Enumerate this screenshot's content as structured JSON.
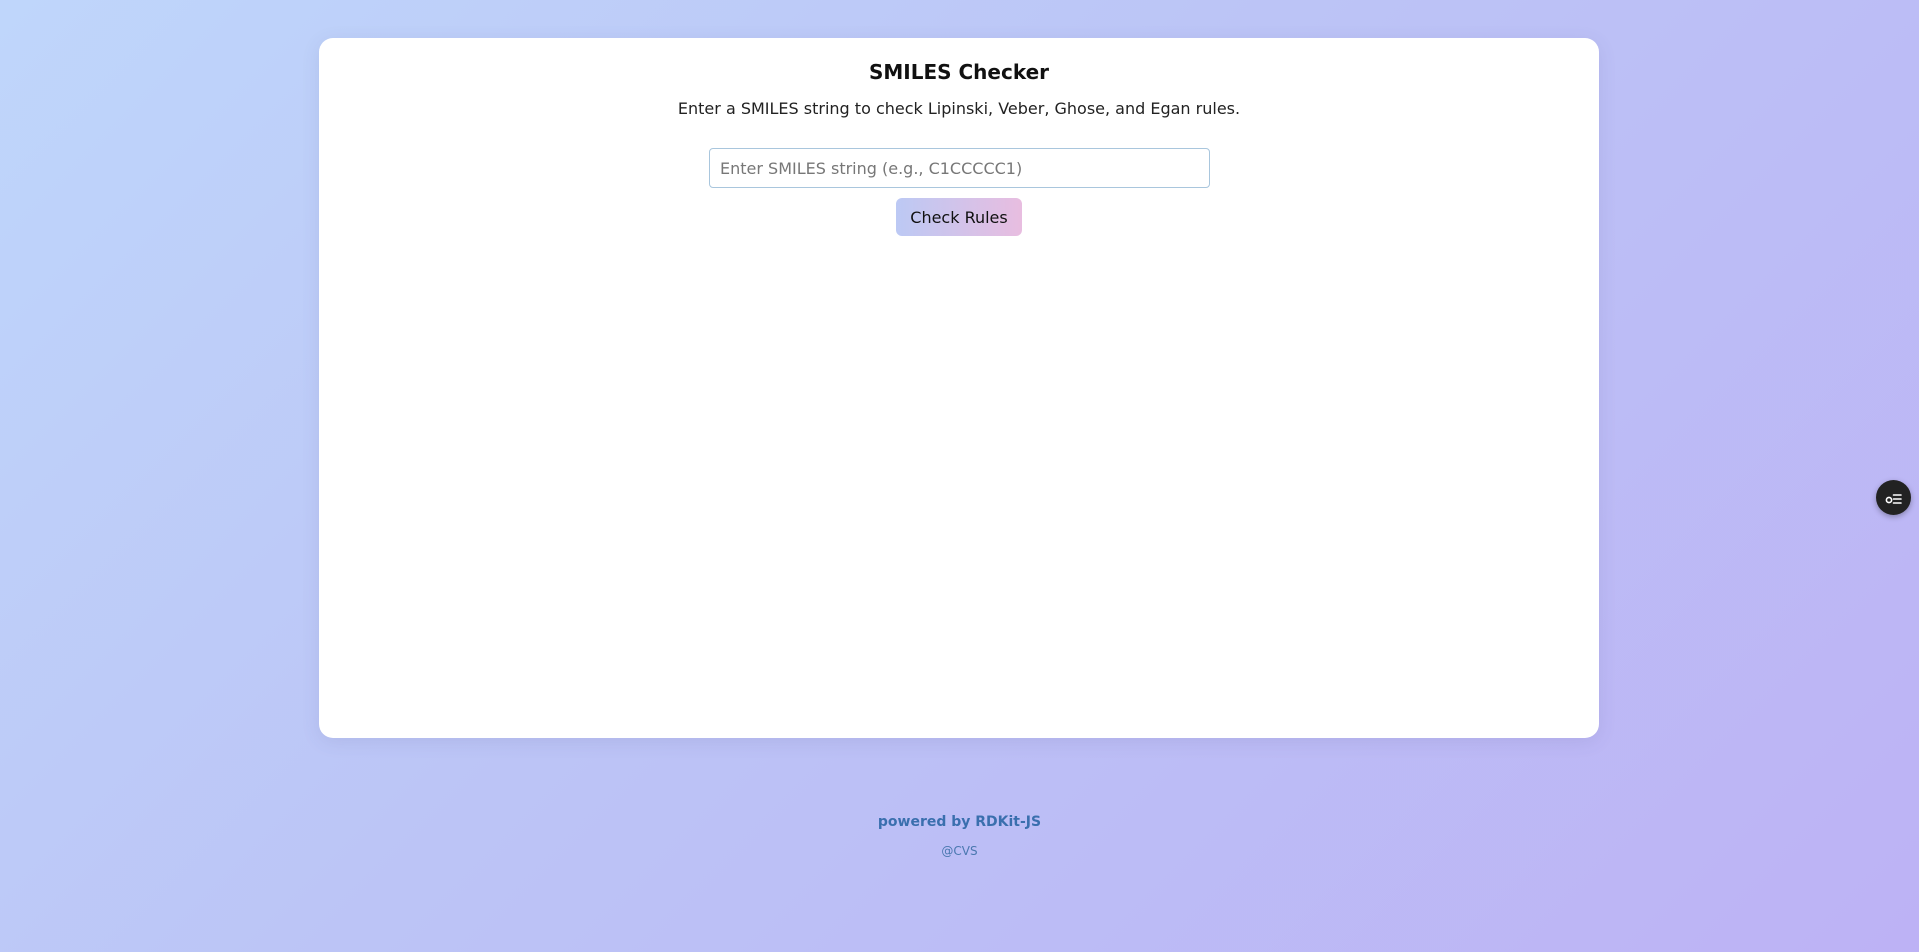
{
  "card": {
    "title": "SMILES Checker",
    "subtitle": "Enter a SMILES string to check Lipinski, Veber, Ghose, and Egan rules.",
    "input": {
      "value": "",
      "placeholder": "Enter SMILES string (e.g., C1CCCCC1)"
    },
    "check_button_label": "Check Rules"
  },
  "footer": {
    "powered_by": "powered by RDKit-JS",
    "credit": "@CVS"
  },
  "widget": {
    "icon": "settings-toggle-icon"
  },
  "colors": {
    "background_start": "#bfd6fb",
    "background_end": "#bdb2f5",
    "card": "#ffffff",
    "button_gradient_start": "#bcc9f4",
    "button_gradient_end": "#e8bde0",
    "footer_text": "#3a6fae",
    "widget": "#222222"
  }
}
